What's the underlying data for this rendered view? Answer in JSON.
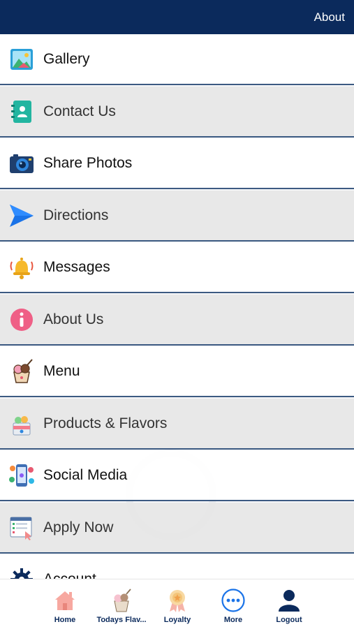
{
  "header": {
    "about_label": "About",
    "bar_color": "#0b2a5c"
  },
  "menu": {
    "items": [
      {
        "label": "Gallery",
        "icon": "gallery-icon"
      },
      {
        "label": "Contact Us",
        "icon": "contact-book-icon"
      },
      {
        "label": "Share Photos",
        "icon": "camera-icon"
      },
      {
        "label": "Directions",
        "icon": "navigation-arrow-icon"
      },
      {
        "label": "Messages",
        "icon": "bell-icon"
      },
      {
        "label": "About Us",
        "icon": "info-icon"
      },
      {
        "label": "Menu",
        "icon": "ice-cream-cup-icon"
      },
      {
        "label": "Products & Flavors",
        "icon": "ice-cream-box-icon"
      },
      {
        "label": "Social Media",
        "icon": "social-media-phone-icon"
      },
      {
        "label": "Apply Now",
        "icon": "application-form-icon"
      },
      {
        "label": "Account",
        "icon": "gear-icon"
      }
    ]
  },
  "tabbar": {
    "items": [
      {
        "label": "Home",
        "icon": "home-icon"
      },
      {
        "label": "Todays Flav...",
        "icon": "ice-cream-icon"
      },
      {
        "label": "Loyalty",
        "icon": "ribbon-award-icon"
      },
      {
        "label": "More",
        "icon": "more-dots-icon"
      },
      {
        "label": "Logout",
        "icon": "user-logout-icon"
      }
    ]
  },
  "colors": {
    "accent": "#0b2a5c",
    "divider": "#3c5a82",
    "tab_label": "#0b2a5c"
  }
}
